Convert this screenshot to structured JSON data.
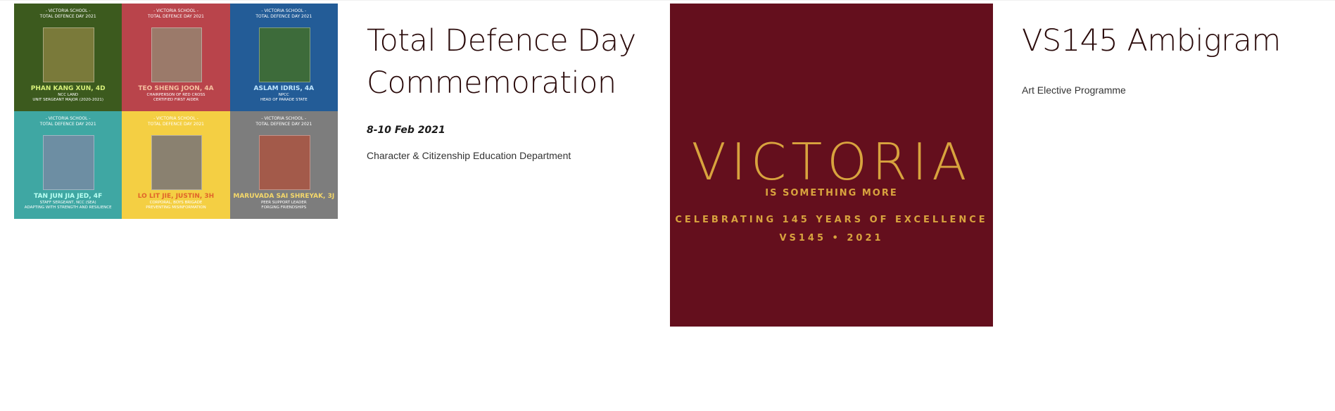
{
  "projects": [
    {
      "title": "Total Defence Day Commemoration",
      "date": "8-10 Feb 2021",
      "department": "Character & Citizenship Education Department",
      "image": {
        "tiles": [
          {
            "school": "- VICTORIA SCHOOL -",
            "event": "TOTAL DEFENCE DAY 2021",
            "name": "PHAN KANG XUN, 4D",
            "role": "NCC LAND\nUNIT SERGEANT MAJOR (2020-2021)",
            "bg": "#3c5a1e",
            "name_color": "#d7f07a",
            "photo": "#7a7a3a"
          },
          {
            "school": "- VICTORIA SCHOOL -",
            "event": "TOTAL DEFENCE DAY 2021",
            "name": "TEO SHENG JOON, 4A",
            "role": "CHAIRPERSON OF RED CROSS\nCERTIFIED FIRST AIDER",
            "bg": "#b9444b",
            "name_color": "#f5c0a0",
            "photo": "#9b7a6a"
          },
          {
            "school": "- VICTORIA SCHOOL -",
            "event": "TOTAL DEFENCE DAY 2021",
            "name": "ASLAM IDRIS, 4A",
            "role": "NPCC\nHEAD OF PARADE STATE",
            "bg": "#235c97",
            "name_color": "#bfe6ff",
            "photo": "#3d6b3a"
          },
          {
            "school": "- VICTORIA SCHOOL -",
            "event": "TOTAL DEFENCE DAY 2021",
            "name": "TAN JUN JIA JED, 4F",
            "role": "STAFF SERGEANT, NCC (SEA)\nADAPTING WITH STRENGTH AND RESILIENCE",
            "bg": "#3fa7a3",
            "name_color": "#b9fff2",
            "photo": "#6d8ea3"
          },
          {
            "school": "- VICTORIA SCHOOL -",
            "event": "TOTAL DEFENCE DAY 2021",
            "name": "LO LIT JIE, JUSTIN, 3H",
            "role": "CORPORAL, BOYS BRIGADE\nPREVENTING MISINFORMATION",
            "bg": "#f4cf43",
            "name_color": "#e0642a",
            "photo": "#8a8170"
          },
          {
            "school": "- VICTORIA SCHOOL -",
            "event": "TOTAL DEFENCE DAY 2021",
            "name": "MARUVADA SAI SHREYAK, 3J",
            "role": "PEER SUPPORT LEADER\nFORGING FRIENDSHIPS",
            "bg": "#7d7d7d",
            "name_color": "#f5d86a",
            "photo": "#a35a4a"
          }
        ]
      }
    },
    {
      "title": "VS145 Ambigram",
      "department": "Art Elective Programme",
      "image": {
        "wordmark": "VICTORIA",
        "tagline": "IS SOMETHING MORE",
        "celebrating": "CELEBRATING 145 YEARS OF EXCELLENCE",
        "year": "VS145 • 2021",
        "bg": "#640f1d",
        "gold": "#d8a33e"
      }
    }
  ]
}
